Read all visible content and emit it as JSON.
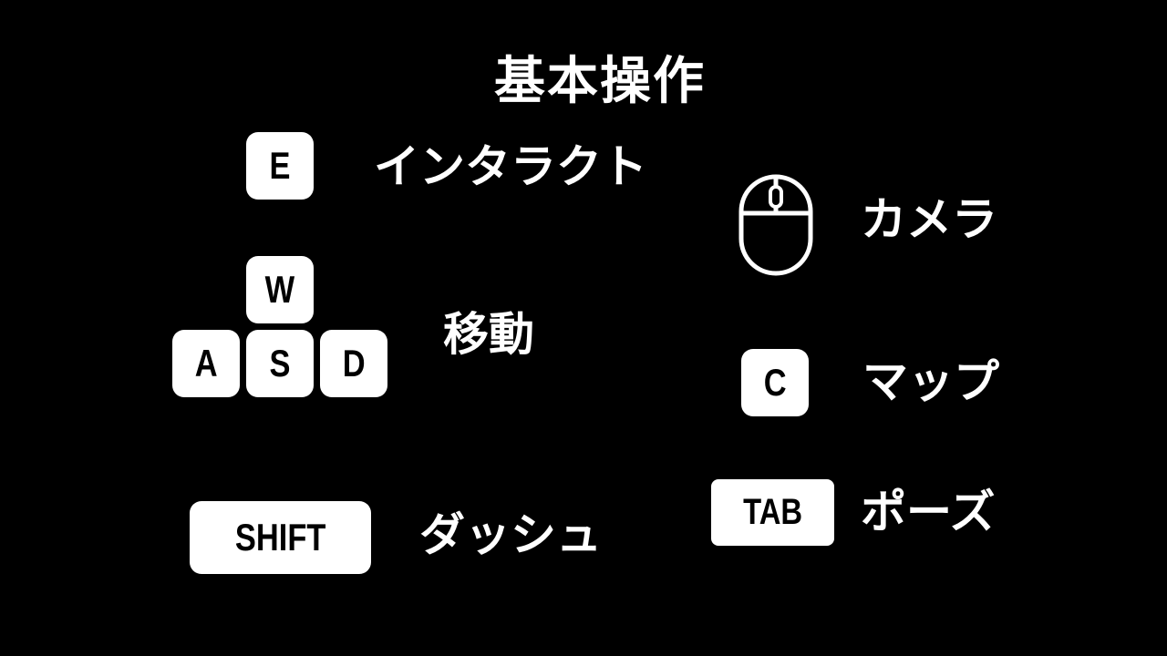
{
  "screen": {
    "title": "基本操作"
  },
  "controls": {
    "interact": {
      "key": "E",
      "action": "インタラクト"
    },
    "move": {
      "keys": [
        "W",
        "A",
        "S",
        "D"
      ],
      "action": "移動"
    },
    "dash": {
      "key": "SHIFT",
      "action": "ダッシュ"
    },
    "camera": {
      "icon": "mouse-icon",
      "action": "カメラ"
    },
    "map": {
      "key": "C",
      "action": "マップ"
    },
    "pause": {
      "key": "TAB",
      "action": "ポーズ"
    }
  },
  "colors": {
    "background": "#000000",
    "key_face": "#ffffff",
    "key_text": "#000000",
    "text": "#ffffff"
  }
}
